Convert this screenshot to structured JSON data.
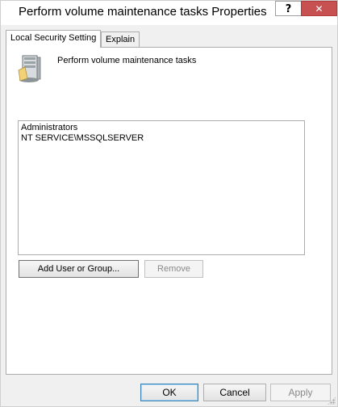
{
  "window": {
    "title": "Perform volume maintenance tasks Properties",
    "help_label": "?",
    "close_label": "✕"
  },
  "tabs": [
    {
      "label": "Local Security Setting",
      "active": true
    },
    {
      "label": "Explain",
      "active": false
    }
  ],
  "policy": {
    "icon": "server-icon",
    "label": "Perform volume maintenance tasks"
  },
  "members": [
    "Administrators",
    "NT SERVICE\\MSSQLSERVER"
  ],
  "buttons": {
    "add_user": "Add User or Group...",
    "remove": "Remove",
    "ok": "OK",
    "cancel": "Cancel",
    "apply": "Apply"
  },
  "colors": {
    "close_button": "#c75050",
    "dialog_background": "#f0f0f0",
    "default_button_border": "#3c7fb1"
  }
}
